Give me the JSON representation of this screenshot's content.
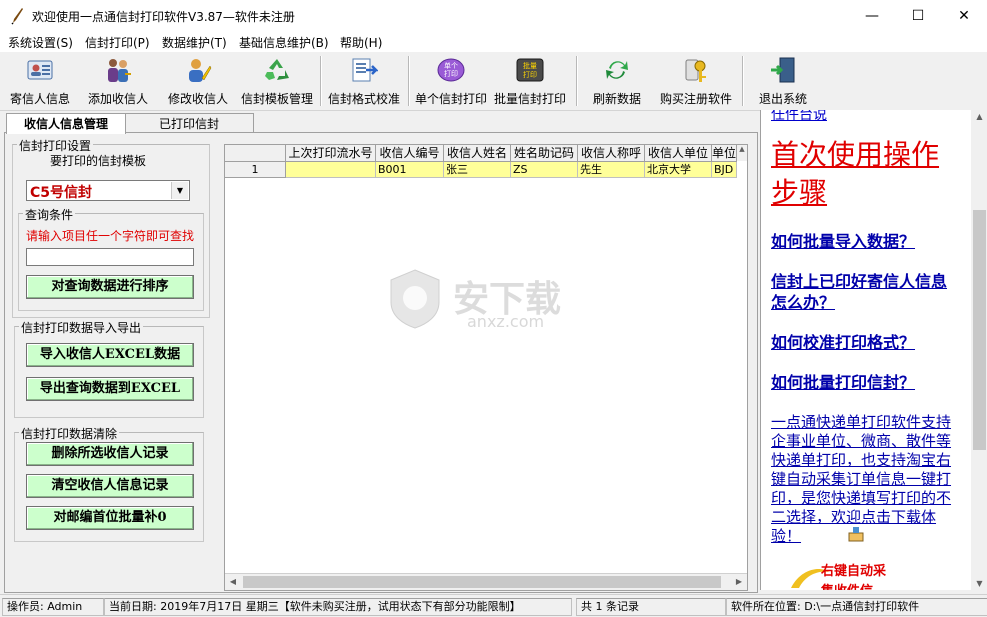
{
  "window": {
    "title": "欢迎使用一点通信封打印软件V3.87—软件未注册",
    "minimize": "—",
    "maximize": "☐",
    "close": "✕"
  },
  "menu": [
    "系统设置(S)",
    "信封打印(P)",
    "数据维护(T)",
    "基础信息维护(B)",
    "帮助(H)"
  ],
  "toolbar": [
    {
      "label": "寄信人信息",
      "icon": "sender-card-icon"
    },
    {
      "label": "添加收信人",
      "icon": "add-people-icon"
    },
    {
      "label": "修改收信人",
      "icon": "edit-user-icon"
    },
    {
      "label": "信封模板管理",
      "icon": "recycle-icon"
    },
    {
      "label": "信封格式校准",
      "icon": "calibrate-icon"
    },
    {
      "label": "单个信封打印",
      "icon": "single-print-icon"
    },
    {
      "label": "批量信封打印",
      "icon": "batch-print-icon"
    },
    {
      "label": "刷新数据",
      "icon": "refresh-icon"
    },
    {
      "label": "购买注册软件",
      "icon": "keys-icon"
    },
    {
      "label": "退出系统",
      "icon": "exit-door-icon"
    }
  ],
  "single_print_badge": "单个\n打印",
  "batch_print_badge": "批量\n打印",
  "tabs": [
    "收信人信息管理",
    "已打印信封"
  ],
  "left": {
    "print_settings_title": "信封打印设置",
    "template_label": "要打印的信封模板",
    "template_value": "C5号信封",
    "query_title": "查询条件",
    "query_hint": "请输入项目任一个字符即可查找",
    "query_value": "",
    "sort_button": "对查询数据进行排序",
    "import_export_title": "信封打印数据导入导出",
    "import_button": "导入收信人EXCEL数据",
    "export_button": "导出查询数据到EXCEL",
    "clear_title": "信封打印数据清除",
    "delete_button": "删除所选收信人记录",
    "clear_button": "清空收信人信息记录",
    "fill_button": "对邮编首位批量补0"
  },
  "grid": {
    "columns": [
      "上次打印流水号",
      "收信人编号",
      "收信人姓名",
      "姓名助记码",
      "收信人称呼",
      "收信人单位",
      "单位"
    ],
    "rows": [
      {
        "no": "1",
        "cells": [
          "",
          "B001",
          "张三",
          "ZS",
          "先生",
          "北京大学",
          "BJD"
        ]
      }
    ]
  },
  "watermark": {
    "cn": "安下载",
    "en": "anxz.com"
  },
  "right": {
    "top_cut": "任件台说",
    "headline": "首次使用操作步骤",
    "links": [
      "如何批量导入数据？",
      "信封上已印好寄信人信息怎么办？",
      "如何校准打印格式？",
      "如何批量打印信封？"
    ],
    "paragraph": "一点通快递单打印软件支持企事业单位、微商、散件等快递单打印，也支持淘宝右键自动采集订单信息一键打印，是您快递填写打印的不二选择，欢迎点击下载体验！",
    "bottom_text": "右键自动采\n集收件信"
  },
  "status": {
    "operator": "操作员: Admin",
    "date": "当前日期: 2019年7月17日 星期三【软件未购买注册，试用状态下有部分功能限制】",
    "count": "共 1 条记录",
    "location": "软件所在位置: D:\\一点通信封打印软件"
  },
  "colors": {
    "button_green": "#ccffcc",
    "row_highlight": "#ffff99",
    "accent_red": "#e00000",
    "link_blue": "#0000aa"
  }
}
